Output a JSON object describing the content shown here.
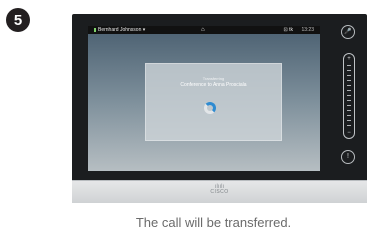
{
  "step_number": "5",
  "device": {
    "topbar": {
      "caller_name": "Bernhard Johnsson",
      "dropdown_glyph": "▾",
      "home_icon": "home-icon",
      "camera_label": "⊡ tk",
      "clock": "13:23"
    },
    "dialog": {
      "status": "Transferring",
      "message": "Conference to Anna Prosciala"
    },
    "side_controls": {
      "mic_glyph": "🎤",
      "volume_plus": "+",
      "volume_minus": "−",
      "info_glyph": "!"
    },
    "brand_bars": "ılıılı",
    "brand_text": "CISCO"
  },
  "caption": "The call will be transferred."
}
